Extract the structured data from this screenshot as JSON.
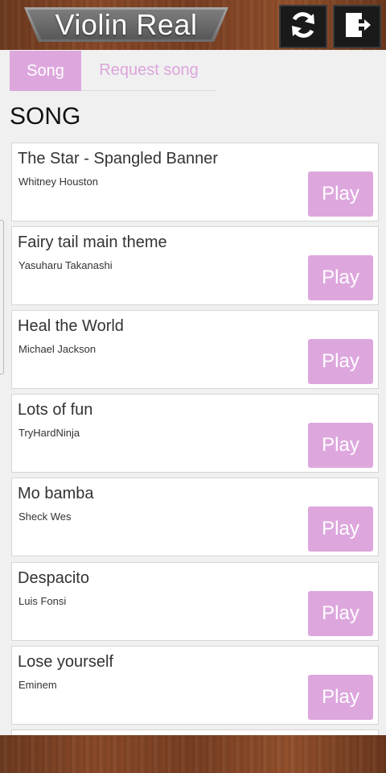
{
  "app": {
    "title": "Violin Real"
  },
  "toolbar": {
    "refresh_icon": "refresh-icon",
    "exit_icon": "exit-door-icon"
  },
  "tabs": [
    {
      "label": "Song",
      "active": true
    },
    {
      "label": "Request song",
      "active": false
    }
  ],
  "section": {
    "title": "SONG"
  },
  "songs": [
    {
      "title": "The Star - Spangled Banner",
      "artist": "Whitney Houston",
      "action": "Play"
    },
    {
      "title": "Fairy tail main theme",
      "artist": "Yasuharu Takanashi",
      "action": "Play"
    },
    {
      "title": "Heal the World",
      "artist": "Michael Jackson",
      "action": "Play"
    },
    {
      "title": "Lots of fun",
      "artist": "TryHardNinja",
      "action": "Play"
    },
    {
      "title": "Mo bamba",
      "artist": "Sheck Wes",
      "action": "Play"
    },
    {
      "title": "Despacito",
      "artist": "Luis Fonsi",
      "action": "Play"
    },
    {
      "title": "Lose yourself",
      "artist": "Eminem",
      "action": "Play"
    }
  ],
  "colors": {
    "accent": "#dda7dd",
    "wood": "#7a3f22",
    "card_border": "#d6d6d6"
  }
}
